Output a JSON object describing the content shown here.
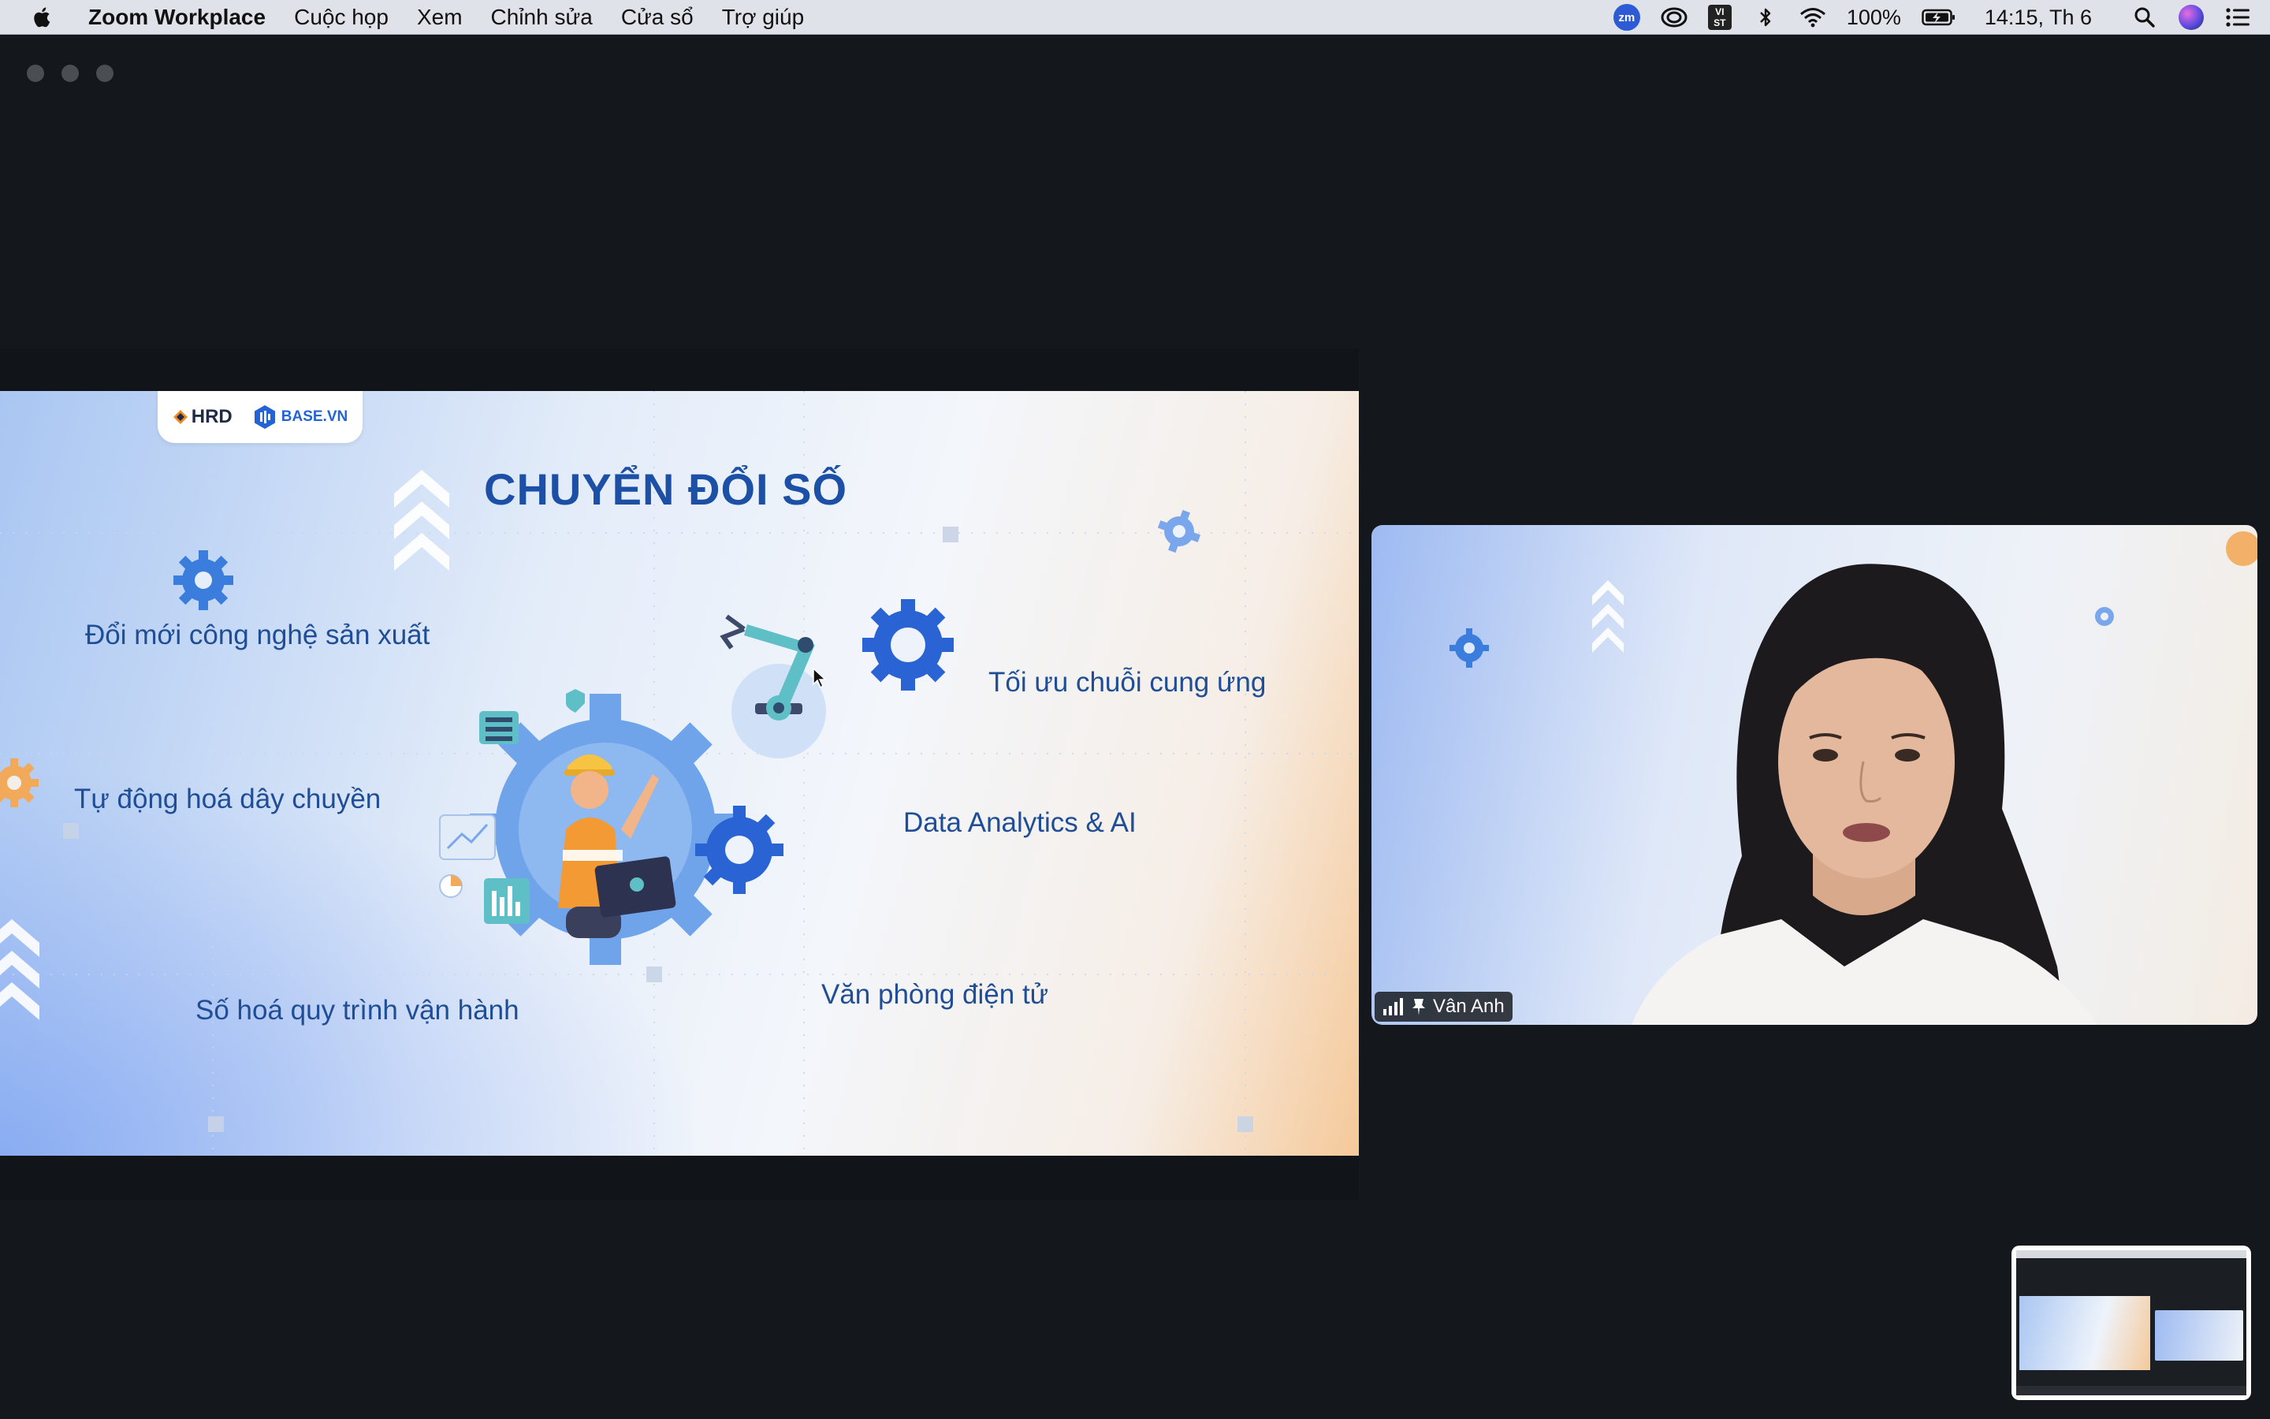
{
  "menubar": {
    "app_name": "Zoom Workplace",
    "menus": [
      "Cuộc họp",
      "Xem",
      "Chỉnh sửa",
      "Cửa sổ",
      "Trợ giúp"
    ],
    "zoom_badge": "zm",
    "vist_badge_top": "VI",
    "vist_badge_bottom": "ST",
    "battery": "100%",
    "clock": "14:15, Th 6"
  },
  "slide": {
    "logo_hrd": "HRD",
    "logo_base": "BASE.VN",
    "title": "CHUYỂN ĐỔI SỐ",
    "labels": {
      "innovation": "Đổi mới công nghệ sản xuất",
      "automation": "Tự động hoá dây chuyền",
      "process": "Số hoá quy trình vận hành",
      "supply_chain": "Tối ưu chuỗi cung ứng",
      "analytics": "Data Analytics & AI",
      "office": "Văn phòng điện tử"
    }
  },
  "video": {
    "participant_name": "Vân Anh"
  },
  "colors": {
    "slide_title": "#1c4fa6",
    "slide_text": "#1f4d96",
    "gear_blue": "#2a63d4",
    "app_background": "#14181d"
  }
}
